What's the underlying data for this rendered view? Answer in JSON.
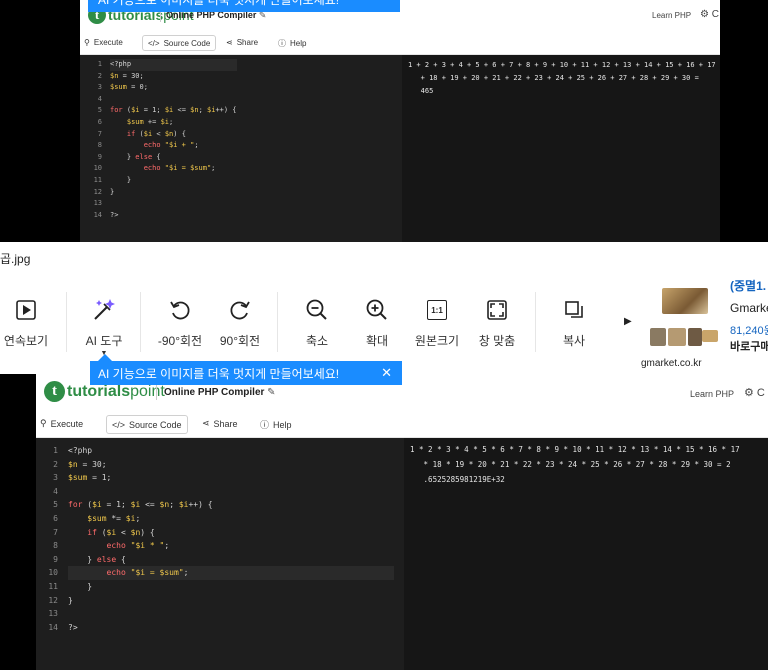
{
  "compiler": {
    "brand_prefix": "tutorials",
    "brand_suffix": "point",
    "title": "Online PHP Compiler",
    "learn_link": "Learn PHP",
    "toolbar": {
      "execute": "Execute",
      "source_code": "Source Code",
      "share": "Share",
      "help": "Help"
    }
  },
  "top_window": {
    "line_numbers": [
      "1",
      "2",
      "3",
      "4",
      "5",
      "6",
      "7",
      "8",
      "9",
      "10",
      "11",
      "12",
      "13",
      "14"
    ],
    "code": [
      "<?php",
      "$n = 30;",
      "$sum = 0;",
      "",
      "for ($i = 1; $i <= $n; $i++) {",
      "    $sum += $i;",
      "    if ($i < $n) {",
      "        echo \"$i + \";",
      "    } else {",
      "        echo \"$i = $sum\";",
      "    }",
      "}",
      "",
      "?>"
    ],
    "output": [
      "1 + 2 + 3 + 4 + 5 + 6 + 7 + 8 + 9 + 10 + 11 + 12 + 13 + 14 + 15 + 16 + 17",
      "   + 18 + 19 + 20 + 21 + 22 + 23 + 24 + 25 + 26 + 27 + 28 + 29 + 30 =",
      "   465"
    ]
  },
  "bottom_window": {
    "line_numbers": [
      "1",
      "2",
      "3",
      "4",
      "5",
      "6",
      "7",
      "8",
      "9",
      "10",
      "11",
      "12",
      "13",
      "14"
    ],
    "code": [
      "<?php",
      "$n = 30;",
      "$sum = 1;",
      "",
      "for ($i = 1; $i <= $n; $i++) {",
      "    $sum *= $i;",
      "    if ($i < $n) {",
      "        echo \"$i * \";",
      "    } else {",
      "        echo \"$i = $sum\";",
      "    }",
      "}",
      "",
      "?>"
    ],
    "output": [
      "1 * 2 * 3 * 4 * 5 * 6 * 7 * 8 * 9 * 10 * 11 * 12 * 13 * 14 * 15 * 16 * 17",
      "   * 18 * 19 * 20 * 21 * 22 * 23 * 24 * 25 * 26 * 27 * 28 * 29 * 30 = 2",
      "   .6525285981219E+32"
    ]
  },
  "viewer": {
    "filename": "곱.jpg",
    "tools": [
      {
        "label": "연속보기",
        "icon": "slideshow-icon"
      },
      {
        "label": "AI 도구",
        "icon": "ai-wand-icon"
      },
      {
        "label": "-90°회전",
        "icon": "rotate-left-icon"
      },
      {
        "label": "90°회전",
        "icon": "rotate-right-icon"
      },
      {
        "label": "축소",
        "icon": "zoom-out-icon"
      },
      {
        "label": "확대",
        "icon": "zoom-in-icon"
      },
      {
        "label": "원본크기",
        "icon": "actual-size-icon"
      },
      {
        "label": "창 맞춤",
        "icon": "fit-window-icon"
      },
      {
        "label": "복사",
        "icon": "copy-icon"
      }
    ],
    "actual_size_glyph": "1:1",
    "banner_text": "AI 기능으로 이미지를 더욱 멋지게 만들어보세요!",
    "banner_close": "✕",
    "ad": {
      "headline": "(중멸1.",
      "store": "Gmarke",
      "price": "81,240원",
      "cta": "바로구매",
      "domain": "gmarket.co.kr"
    }
  }
}
